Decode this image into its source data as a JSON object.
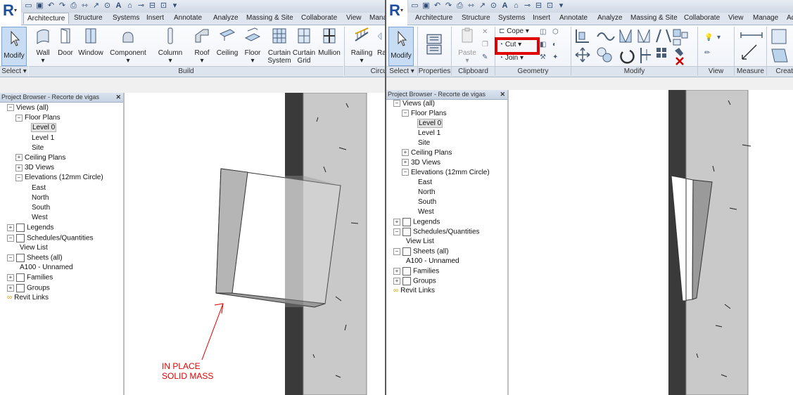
{
  "left": {
    "tabs": [
      "Architecture",
      "Structure",
      "Systems",
      "Insert",
      "Annotate",
      "Analyze",
      "Massing & Site",
      "Collaborate",
      "View",
      "Manag"
    ],
    "ribbon": {
      "modify": "Modify",
      "wall": "Wall",
      "door": "Door",
      "window": "Window",
      "component": "Component",
      "column": "Column",
      "roof": "Roof",
      "ceiling": "Ceiling",
      "floor": "Floor",
      "curtain_system": [
        "Curtain",
        "System"
      ],
      "curtain_grid": [
        "Curtain",
        "Grid"
      ],
      "mullion": "Mullion",
      "railing": "Railing",
      "ramp_cut": "Ra",
      "groups": {
        "select": "Select",
        "build": "Build",
        "circ": "Circu"
      }
    },
    "browser_title": "Project Browser - Recorte de vigas",
    "annotation": [
      "IN PLACE",
      "SOLID MASS"
    ]
  },
  "right": {
    "tabs": [
      "Architecture",
      "Structure",
      "Systems",
      "Insert",
      "Annotate",
      "Analyze",
      "Massing & Site",
      "Collaborate",
      "View",
      "Manage",
      "Ad"
    ],
    "ribbon": {
      "modify": "Modify",
      "paste": "Paste",
      "cope": "Cope",
      "cut": "Cut",
      "join": "Join",
      "groups": {
        "select": "Select",
        "properties": "Properties",
        "clipboard": "Clipboard",
        "geometry": "Geometry",
        "modify": "Modify",
        "view": "View",
        "measure": "Measure",
        "create": "Creat"
      }
    },
    "browser_title": "Project Browser - Recorte de vigas"
  },
  "tree": [
    {
      "label": "Views (all)",
      "exp": "−"
    },
    {
      "label": "Floor Plans",
      "exp": "−"
    },
    {
      "label": "Level 0",
      "selected": true
    },
    {
      "label": "Level 1"
    },
    {
      "label": "Site"
    },
    {
      "label": "Ceiling Plans",
      "exp": "+"
    },
    {
      "label": "3D Views",
      "exp": "+"
    },
    {
      "label": "Elevations (12mm Circle)",
      "exp": "−"
    },
    {
      "label": "East"
    },
    {
      "label": "North"
    },
    {
      "label": "South"
    },
    {
      "label": "West"
    },
    {
      "label": "Legends",
      "exp": "+"
    },
    {
      "label": "Schedules/Quantities",
      "exp": "−"
    },
    {
      "label": "View List"
    },
    {
      "label": "Sheets (all)",
      "exp": "−"
    },
    {
      "label": "A100 - Unnamed"
    },
    {
      "label": "Families",
      "exp": "+"
    },
    {
      "label": "Groups",
      "exp": "+"
    },
    {
      "label": "Revit Links"
    }
  ],
  "colors": {
    "highlight": "#e00000",
    "accent": "#1e4f9c"
  }
}
